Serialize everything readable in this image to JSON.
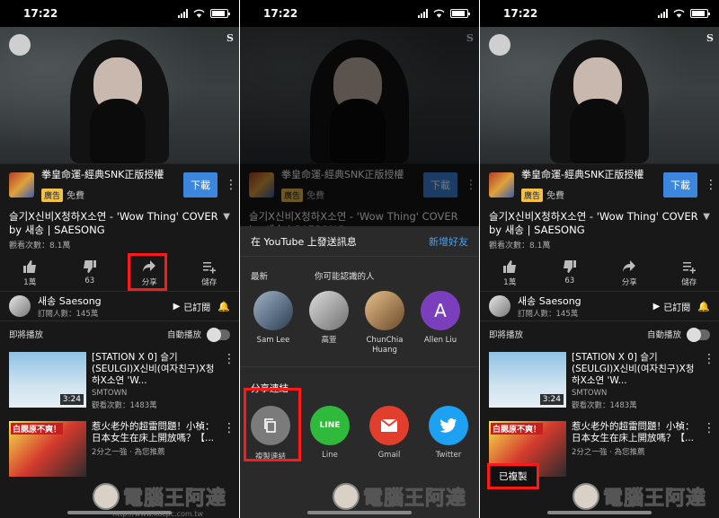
{
  "status": {
    "time": "17:22"
  },
  "video": {
    "subtitle": "",
    "channel_badge": "S"
  },
  "ad": {
    "title": "拳皇命運-經典SNK正版授權",
    "tag": "廣告",
    "free": "免費",
    "download": "下載"
  },
  "video_info": {
    "title": "슬기X신비X청하X소연 - 'Wow Thing' COVER by 새송 | SAESONG",
    "views": "觀看次數：8.1萬"
  },
  "actions": [
    {
      "label": "1萬"
    },
    {
      "label": "63"
    },
    {
      "label": "分享"
    },
    {
      "label": "儲存"
    }
  ],
  "channel": {
    "name": "새송 Saesong",
    "subs": "訂閱人數：145萬",
    "subscribed": "已訂閱"
  },
  "up_next": {
    "label": "即將播放",
    "autoplay": "自動播放"
  },
  "videos": [
    {
      "title": "[STATION X 0] 슬기 (SEULGI)X신비(여자친구)X청하X소연 'W...",
      "channel": "SMTOWN",
      "views": "觀看次數：1483萬",
      "duration": "3:24"
    },
    {
      "title": "惹火老外的超雷問題！小楨：日本女生在床上開放嗎？【...",
      "meta": "2分之一強 · 為您推薦",
      "thumb_text": "白腮原不爽！"
    }
  ],
  "sheet": {
    "title": "在 YouTube 上發送訊息",
    "add_friend": "新增好友",
    "recent": "最新",
    "suggested": "你可能認識的人",
    "contacts": [
      {
        "name": "Sam Lee",
        "initial": ""
      },
      {
        "name": "高萱",
        "initial": ""
      },
      {
        "name": "ChunChia Huang",
        "initial": ""
      },
      {
        "name": "Allen Liu",
        "initial": "A"
      }
    ],
    "share_link": "分享連結",
    "apps": [
      {
        "name": "複製連結"
      },
      {
        "name": "Line",
        "glyph": "LINE"
      },
      {
        "name": "Gmail"
      },
      {
        "name": "Twitter"
      }
    ]
  },
  "toast": "已複製",
  "watermark": {
    "text": "電腦王阿達",
    "url": "http://www.kocpc.com.tw"
  },
  "colors": {
    "accent_red": "#ff1a1a",
    "download_blue": "#3d86de",
    "link_blue": "#4a9ff0"
  }
}
